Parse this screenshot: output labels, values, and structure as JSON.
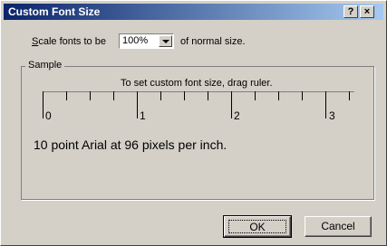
{
  "dialog": {
    "title": "Custom Font Size",
    "help_glyph": "?",
    "close_glyph": "×"
  },
  "scale": {
    "label_mnemonic": "S",
    "label_rest": "cale fonts to be",
    "value": "100%",
    "suffix": "of normal size."
  },
  "sample": {
    "group_label": "Sample",
    "hint": "To set custom font size, drag ruler.",
    "ruler_numbers": [
      "0",
      "1",
      "2",
      "3"
    ],
    "text": "10 point Arial at 96 pixels per inch."
  },
  "buttons": {
    "ok": "OK",
    "cancel": "Cancel"
  }
}
